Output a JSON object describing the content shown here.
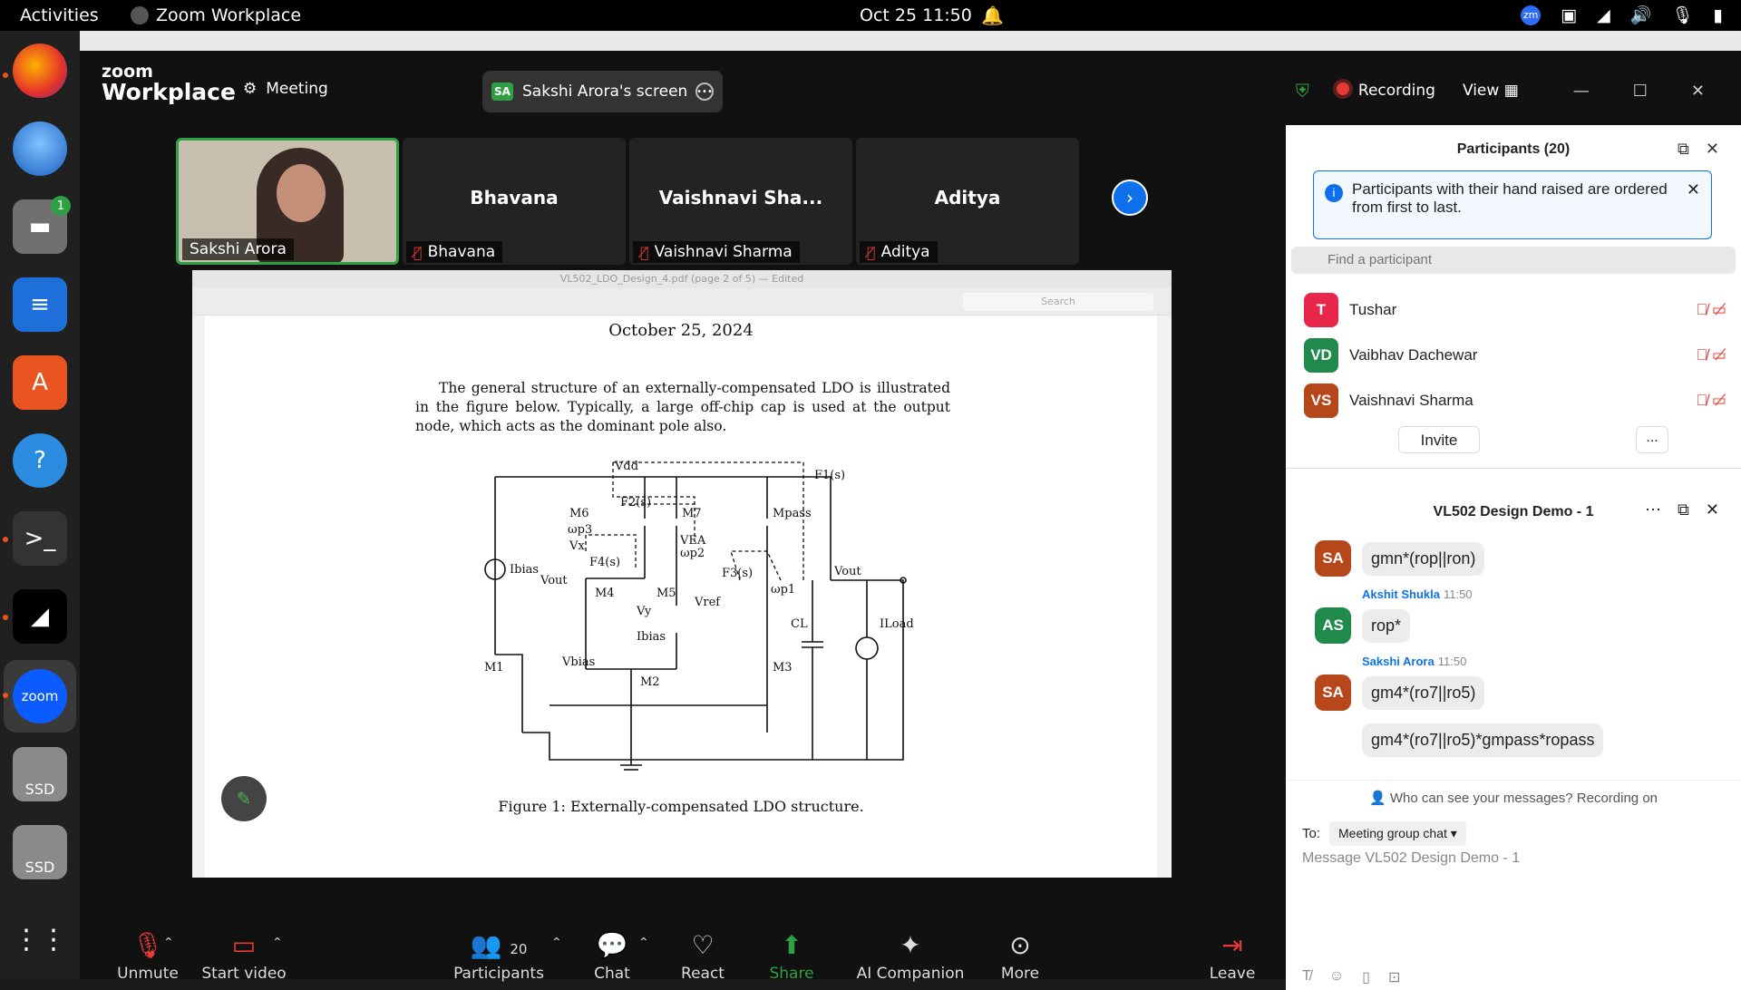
{
  "topbar": {
    "activities": "Activities",
    "app_name": "Zoom Workplace",
    "clock": "Oct 25  11:50",
    "zm_badge": "zm"
  },
  "dock": {
    "files_badge": "1",
    "zoom_label": "zoom",
    "ssd1": "SSD",
    "ssd2": "SSD"
  },
  "header": {
    "logo_top": "zoom",
    "logo_bottom": "Workplace",
    "meeting_label": "Meeting",
    "screen_initials": "SA",
    "screen_label": "Sakshi Arora's screen",
    "recording_label": "Recording",
    "view_label": "View"
  },
  "thumbnails": [
    {
      "big": "",
      "tag": "Sakshi Arora"
    },
    {
      "big": "Bhavana",
      "tag": "Bhavana"
    },
    {
      "big": "Vaishnavi Sha...",
      "tag": "Vaishnavi Sharma"
    },
    {
      "big": "Aditya",
      "tag": "Aditya"
    }
  ],
  "pdf": {
    "window_title": "VL502_LDO_Design_4.pdf (page 2 of 5) — Edited",
    "search_placeholder": "Search",
    "date": "October 25, 2024",
    "paragraph": "The general structure of an externally-compensated LDO is illustrated in the figure below. Typically, a large off-chip cap is used at the output node, which acts as the dominant pole also.",
    "caption": "Figure 1: Externally-compensated LDO structure.",
    "labels": {
      "vdd": "Vdd",
      "f1": "F1(s)",
      "f2": "F2(s)",
      "f3": "F3(s)",
      "f4": "F4(s)",
      "m6": "M6",
      "m7": "M7",
      "mpass": "Mpass",
      "wp3": "ωp3",
      "vx": "Vx",
      "vea": "VEA",
      "wp2": "ωp2",
      "ibias": "Ibias",
      "vout": "Vout",
      "m4": "M4",
      "m5": "M5",
      "vref": "Vref",
      "wp1": "ωp1",
      "vy": "Vy",
      "ibias2": "Ibias",
      "cl": "CL",
      "iload": "ILoad",
      "m1": "M1",
      "vbias": "Vbias",
      "m2": "M2",
      "m3": "M3",
      "vout2": "Vout"
    }
  },
  "toolbar": {
    "unmute": "Unmute",
    "start_video": "Start video",
    "participants": "Participants",
    "participants_count": "20",
    "chat": "Chat",
    "react": "React",
    "share": "Share",
    "ai_companion": "AI Companion",
    "more": "More",
    "leave": "Leave"
  },
  "participants_panel": {
    "title": "Participants (20)",
    "notice": "Participants with their hand raised are ordered from first to last.",
    "search_placeholder": "Find a participant",
    "people": [
      {
        "initials": "T",
        "name": "Tushar",
        "color": "#e8264a"
      },
      {
        "initials": "VD",
        "name": "Vaibhav Dachewar",
        "color": "#1f8a4c"
      },
      {
        "initials": "VS",
        "name": "Vaishnavi Sharma",
        "color": "#b5471b"
      }
    ],
    "invite": "Invite",
    "more": "..."
  },
  "chat_panel": {
    "title": "VL502 Design Demo - 1",
    "messages": [
      {
        "initials": "SA",
        "text": "gmn*(rop||ron)",
        "color": "#b5471b"
      },
      {
        "sender": "Akshit Shukla",
        "time": "11:50",
        "initials": "AS",
        "text": "rop*",
        "color": "#1f8a4c"
      },
      {
        "sender": "Sakshi Arora",
        "time": "11:50",
        "initials": "SA",
        "text": "gm4*(ro7||ro5)",
        "color": "#b5471b"
      },
      {
        "text": "gm4*(ro7||ro5)*gmpass*ropass"
      }
    ],
    "who_can_see": "Who can see your messages? Recording on",
    "to_label": "To:",
    "to_value": "Meeting group chat",
    "input_placeholder": "Message VL502 Design Demo - 1"
  }
}
